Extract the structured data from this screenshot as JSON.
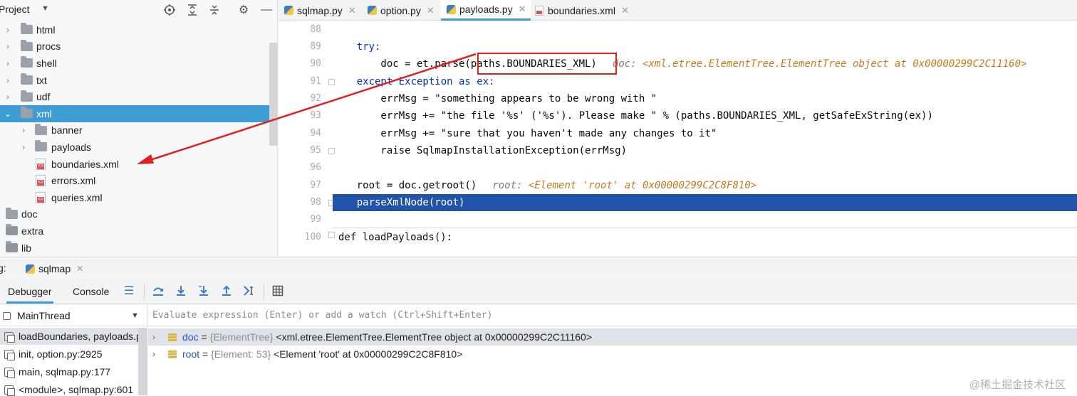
{
  "project_panel": {
    "title": "Project",
    "toolbar_icons": [
      "locate-icon",
      "expand-all-icon",
      "collapse-all-icon",
      "settings-icon",
      "minimize-icon"
    ],
    "tree": [
      {
        "label": "html",
        "type": "folder",
        "depth": 0,
        "expandable": true
      },
      {
        "label": "procs",
        "type": "folder",
        "depth": 0,
        "expandable": true
      },
      {
        "label": "shell",
        "type": "folder",
        "depth": 0,
        "expandable": true
      },
      {
        "label": "txt",
        "type": "folder",
        "depth": 0,
        "expandable": true
      },
      {
        "label": "udf",
        "type": "folder",
        "depth": 0,
        "expandable": true
      },
      {
        "label": "xml",
        "type": "folder",
        "depth": 0,
        "expandable": true,
        "expanded": true,
        "selected": true
      },
      {
        "label": "banner",
        "type": "folder",
        "depth": 1,
        "expandable": true
      },
      {
        "label": "payloads",
        "type": "folder",
        "depth": 1,
        "expandable": true
      },
      {
        "label": "boundaries.xml",
        "type": "xml",
        "depth": 1
      },
      {
        "label": "errors.xml",
        "type": "xml",
        "depth": 1
      },
      {
        "label": "queries.xml",
        "type": "xml",
        "depth": 1
      },
      {
        "label": "doc",
        "type": "folder",
        "depth": -1
      },
      {
        "label": "extra",
        "type": "folder",
        "depth": -1
      },
      {
        "label": "lib",
        "type": "folder",
        "depth": -1
      }
    ]
  },
  "editor": {
    "tabs": [
      {
        "label": "sqlmap.py",
        "icon": "python-file-icon",
        "active": false
      },
      {
        "label": "option.py",
        "icon": "python-file-icon",
        "active": false
      },
      {
        "label": "payloads.py",
        "icon": "python-file-icon",
        "active": true
      },
      {
        "label": "boundaries.xml",
        "icon": "xml-file-icon",
        "active": false
      }
    ],
    "lines": [
      {
        "n": "88",
        "code": ""
      },
      {
        "n": "89",
        "code": "    try:"
      },
      {
        "n": "90",
        "code": "        doc = et.parse(paths.BOUNDARIES_XML)",
        "hint_label": "doc:",
        "hint_value": "<xml.etree.ElementTree.ElementTree object at 0x00000299C2C11160>"
      },
      {
        "n": "91",
        "code": "    except Exception as ex:"
      },
      {
        "n": "92",
        "code": "        errMsg = \"something appears to be wrong with \""
      },
      {
        "n": "93",
        "code": "        errMsg += \"the file '%s' ('%s'). Please make \" % (paths.BOUNDARIES_XML, getSafeExString(ex))"
      },
      {
        "n": "94",
        "code": "        errMsg += \"sure that you haven't made any changes to it\""
      },
      {
        "n": "95",
        "code": "        raise SqlmapInstallationException(errMsg)"
      },
      {
        "n": "96",
        "code": ""
      },
      {
        "n": "97",
        "code": "    root = doc.getroot()",
        "hint_label": "root:",
        "hint_value": "<Element 'root' at 0x00000299C2C8F810>"
      },
      {
        "n": "98",
        "code": "    parseXmlNode(root)",
        "current": true
      },
      {
        "n": "99",
        "code": ""
      },
      {
        "n": "100",
        "code": "def loadPayloads():"
      }
    ]
  },
  "debug": {
    "label": "g:",
    "run_config": "sqlmap",
    "tabs": [
      {
        "label": "Debugger",
        "active": true
      },
      {
        "label": "Console",
        "active": false
      }
    ],
    "toolbar_icons": [
      "menu-icon",
      "step-over-icon",
      "step-into-icon",
      "step-into-my-code-icon",
      "step-out-icon",
      "run-to-cursor-icon",
      "evaluate-icon"
    ],
    "thread": "MainThread",
    "frames": [
      {
        "label": "loadBoundaries, payloads.py",
        "selected": true
      },
      {
        "label": "init, option.py:2925"
      },
      {
        "label": "main, sqlmap.py:177"
      },
      {
        "label": "<module>, sqlmap.py:601"
      }
    ],
    "evaluate_placeholder": "Evaluate expression (Enter) or add a watch (Ctrl+Shift+Enter)",
    "variables": [
      {
        "name": "doc",
        "type": "{ElementTree}",
        "value": "<xml.etree.ElementTree.ElementTree object at 0x00000299C2C11160>",
        "selected": true
      },
      {
        "name": "root",
        "type": "{Element: 53}",
        "value": "<Element 'root' at 0x00000299C2C8F810>"
      }
    ]
  },
  "watermark": "@稀土掘金技术社区",
  "colors": {
    "selection": "#3d9cd1",
    "exec_line": "#2154a8",
    "annotation": "#e02020"
  }
}
